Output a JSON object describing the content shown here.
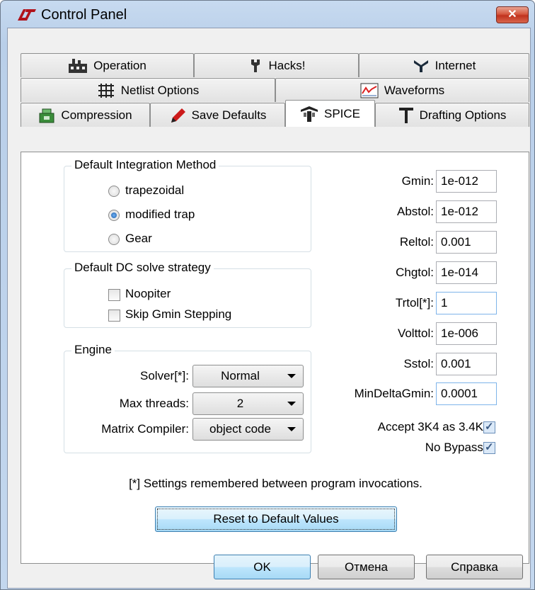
{
  "window": {
    "title": "Control Panel",
    "close_glyph": "✕"
  },
  "tabs": {
    "row1": [
      "Operation",
      "Hacks!",
      "Internet"
    ],
    "row2": [
      "Netlist Options",
      "Waveforms"
    ],
    "row3": [
      "Compression",
      "Save Defaults",
      "SPICE",
      "Drafting Options"
    ],
    "active": "SPICE"
  },
  "integration": {
    "title": "Default Integration Method",
    "options": [
      "trapezoidal",
      "modified trap",
      "Gear"
    ],
    "selected": "modified trap"
  },
  "dc_solve": {
    "title": "Default DC solve strategy",
    "noopiter": {
      "label": "Noopiter",
      "checked": false
    },
    "skip_gmin": {
      "label": "Skip Gmin Stepping",
      "checked": false
    }
  },
  "engine": {
    "title": "Engine",
    "solver": {
      "label": "Solver[*]:",
      "value": "Normal"
    },
    "max_threads": {
      "label": "Max threads:",
      "value": "2"
    },
    "matrix_compiler": {
      "label": "Matrix Compiler:",
      "value": "object code"
    }
  },
  "params": [
    {
      "label": "Gmin:",
      "value": "1e-012"
    },
    {
      "label": "Abstol:",
      "value": "1e-012"
    },
    {
      "label": "Reltol:",
      "value": "0.001"
    },
    {
      "label": "Chgtol:",
      "value": "1e-014"
    },
    {
      "label": "Trtol[*]:",
      "value": "1"
    },
    {
      "label": "Volttol:",
      "value": "1e-006"
    },
    {
      "label": "Sstol:",
      "value": "0.001"
    },
    {
      "label": "MinDeltaGmin:",
      "value": "0.0001"
    }
  ],
  "options": {
    "accept_3k4": {
      "label": "Accept 3K4 as 3.4K[*]",
      "checked": true
    },
    "no_bypass": {
      "label": "No Bypass[*]",
      "checked": true
    }
  },
  "note": "[*] Settings remembered between program invocations.",
  "reset_label": "Reset to Default Values",
  "buttons": {
    "ok": "OK",
    "cancel": "Отмена",
    "help": "Справка"
  },
  "icons": {
    "app": "lt-logo-icon",
    "operation": "factory-icon",
    "hacks": "wrench-icon",
    "internet": "antenna-icon",
    "netlist": "grid-icon",
    "waveforms": "waveform-icon",
    "compression": "compress-icon",
    "save_defaults": "pencil-icon",
    "spice": "spice-icon",
    "drafting": "t-square-icon"
  }
}
